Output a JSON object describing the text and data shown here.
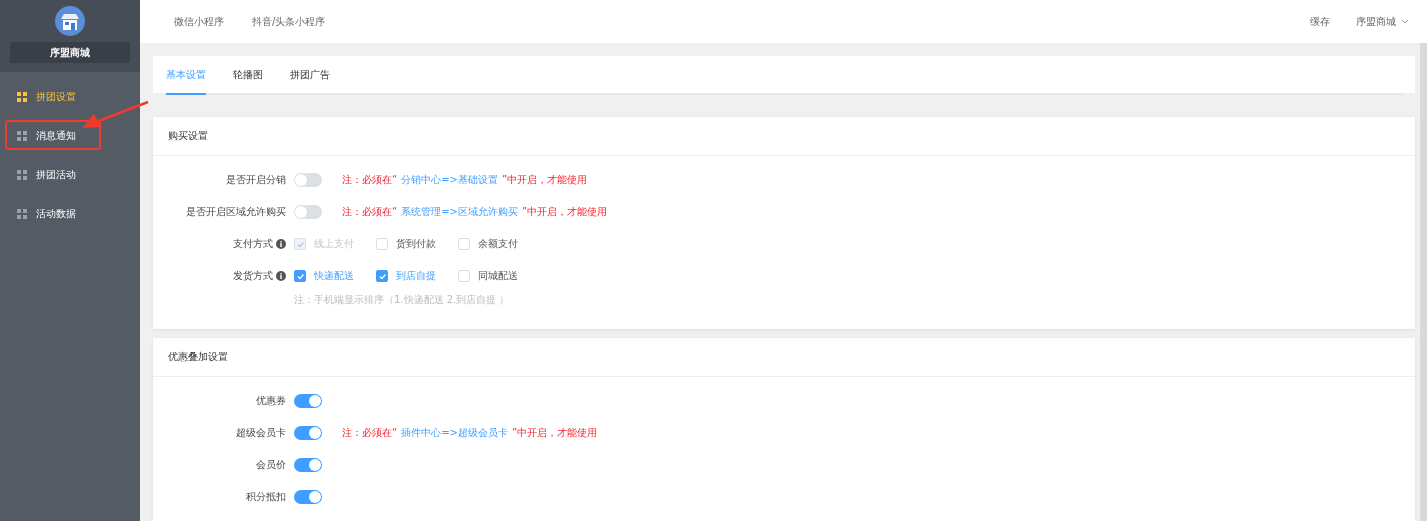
{
  "sidebar": {
    "shop_name": "序盟商城",
    "items": [
      {
        "label": "拼团设置",
        "selected": true,
        "annotated": false
      },
      {
        "label": "消息通知",
        "selected": false,
        "annotated": true
      },
      {
        "label": "拼团活动",
        "selected": false,
        "annotated": false
      },
      {
        "label": "活动数据",
        "selected": false,
        "annotated": false
      }
    ]
  },
  "top_bar": {
    "tabs": [
      {
        "label": "微信小程序"
      },
      {
        "label": "抖音/头条小程序"
      }
    ],
    "right": {
      "cache": "缓存",
      "user": "序盟商城"
    }
  },
  "tabs": [
    {
      "label": "基本设置",
      "selected": true
    },
    {
      "label": "轮播图",
      "selected": false
    },
    {
      "label": "拼团广告",
      "selected": false
    }
  ],
  "sections": [
    {
      "title": "购买设置",
      "rows": [
        {
          "kind": "switch",
          "label": "是否开启分销",
          "on": false,
          "note": {
            "prefix": "注：必须在“",
            "path": "分销中心=>基础设置",
            "suffix": "”中开启，才能使用"
          }
        },
        {
          "kind": "switch",
          "label": "是否开启区域允许购买",
          "on": false,
          "note": {
            "prefix": "注：必须在“",
            "path": "系统管理=>区域允许购买",
            "suffix": "”中开启，才能使用"
          }
        },
        {
          "kind": "checks",
          "label": "支付方式",
          "info": true,
          "options": [
            {
              "label": "线上支付",
              "checked": true,
              "disabled": true
            },
            {
              "label": "货到付款",
              "checked": false,
              "disabled": false
            },
            {
              "label": "余额支付",
              "checked": false,
              "disabled": false
            }
          ]
        },
        {
          "kind": "checks",
          "label": "发货方式",
          "info": true,
          "options": [
            {
              "label": "快递配送",
              "checked": true,
              "disabled": false
            },
            {
              "label": "到店自提",
              "checked": true,
              "disabled": false
            },
            {
              "label": "同城配送",
              "checked": false,
              "disabled": false
            }
          ],
          "hint": "注：手机端显示排序（1.快递配送 2.到店自提 ）"
        }
      ]
    },
    {
      "title": "优惠叠加设置",
      "rows": [
        {
          "kind": "switch",
          "label": "优惠券",
          "on": true
        },
        {
          "kind": "switch",
          "label": "超级会员卡",
          "on": true,
          "note": {
            "prefix": "注：必须在“",
            "path": "插件中心=>超级会员卡",
            "suffix": "”中开启，才能使用"
          }
        },
        {
          "kind": "switch",
          "label": "会员价",
          "on": true
        },
        {
          "kind": "switch",
          "label": "积分抵扣",
          "on": true
        }
      ]
    }
  ]
}
